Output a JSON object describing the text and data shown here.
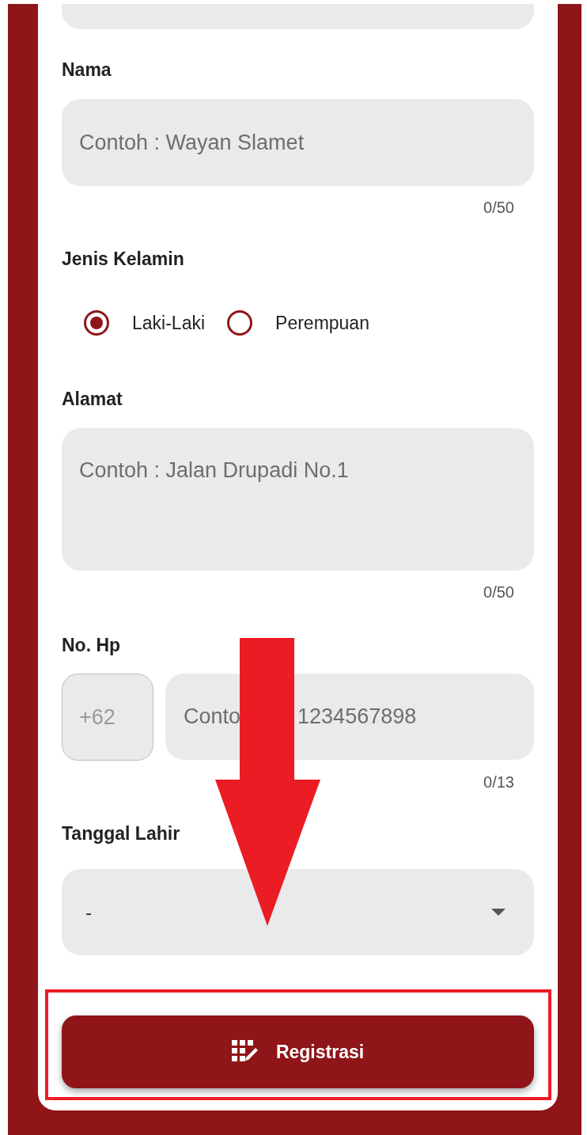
{
  "form": [
    {
      "kind": "text",
      "label": "Nama",
      "placeholder": "Contoh : Wayan Slamet",
      "counter": "0/50"
    },
    {
      "kind": "radio",
      "label": "Jenis Kelamin",
      "options": [
        {
          "label": "Laki-Laki",
          "selected": true
        },
        {
          "label": "Perempuan",
          "selected": false
        }
      ]
    },
    {
      "kind": "textarea",
      "label": "Alamat",
      "placeholder": "Contoh : Jalan Drupadi No.1",
      "counter": "0/50"
    },
    {
      "kind": "phone",
      "label": "No. Hp",
      "prefix": "+62",
      "placeholder_parts": [
        "Conto",
        "1234567898"
      ],
      "counter": "0/13"
    },
    {
      "kind": "dropdown",
      "label": "Tanggal Lahir",
      "value": "-"
    }
  ],
  "submit_button": {
    "label": "Registrasi"
  }
}
